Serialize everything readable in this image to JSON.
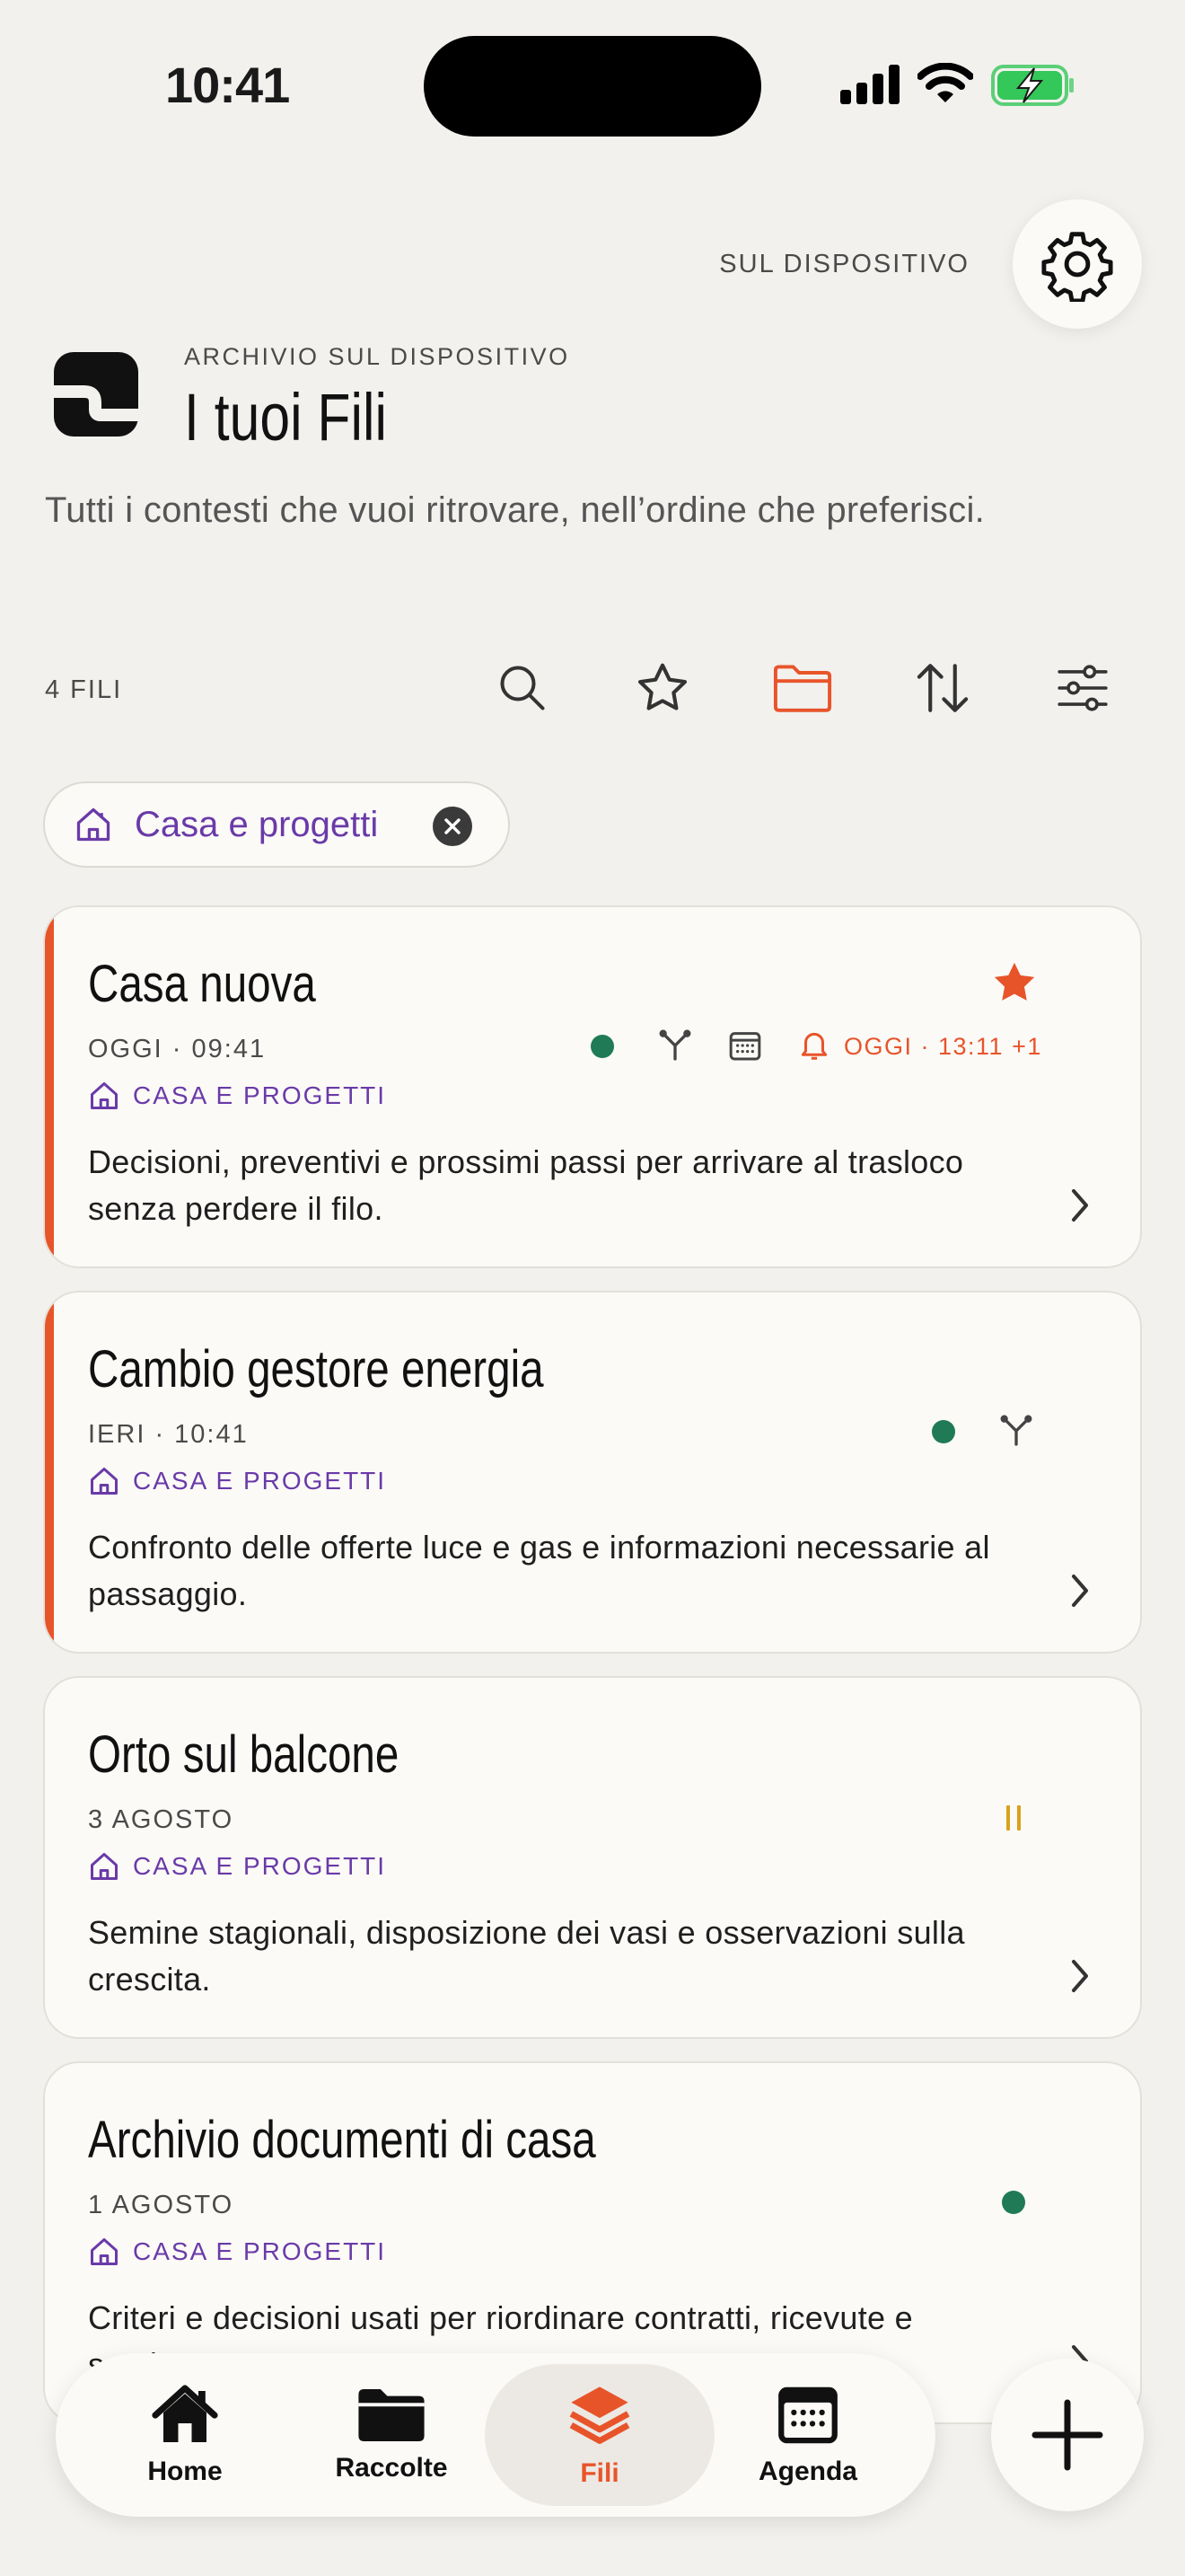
{
  "status": {
    "time": "10:41"
  },
  "header": {
    "device_label": "SUL DISPOSITIVO",
    "overline": "ARCHIVIO SUL DISPOSITIVO",
    "title": "I tuoi Fili",
    "subtitle": "Tutti i contesti che vuoi ritrovare, nell’ordine che preferisci."
  },
  "toolbar": {
    "count": "4 FILI"
  },
  "filter": {
    "label": "Casa e progetti"
  },
  "cards": [
    {
      "title": "Casa nuova",
      "date": "OGGI · 09:41",
      "category": "CASA E PROGETTI",
      "description": "Decisioni, preventivi e prossimi passi per arrivare al trasloco senza perdere il filo.",
      "reminder": "OGGI · 13:11 +1",
      "starred": true
    },
    {
      "title": "Cambio gestore energia",
      "date": "IERI · 10:41",
      "category": "CASA E PROGETTI",
      "description": "Confronto delle offerte luce e gas e informazioni necessarie al passaggio."
    },
    {
      "title": "Orto sul balcone",
      "date": "3 AGOSTO",
      "category": "CASA E PROGETTI",
      "description": "Semine stagionali, disposizione dei vasi e osservazioni sulla crescita."
    },
    {
      "title": "Archivio documenti di casa",
      "date": "1 AGOSTO",
      "category": "CASA E PROGETTI",
      "description": "Criteri e decisioni usati per riordinare contratti, ricevute e scadenze."
    }
  ],
  "nav": [
    {
      "label": "Home",
      "icon": "home-icon"
    },
    {
      "label": "Raccolte",
      "icon": "folder-icon"
    },
    {
      "label": "Fili",
      "icon": "layers-icon",
      "active": true
    },
    {
      "label": "Agenda",
      "icon": "calendar-icon"
    }
  ],
  "colors": {
    "accent": "#E8542A",
    "category": "#6A3AA8",
    "active_dot": "#1F7A55",
    "paused": "#D9A21B",
    "background": "#F2F1EE",
    "card": "#FBFAF7"
  }
}
